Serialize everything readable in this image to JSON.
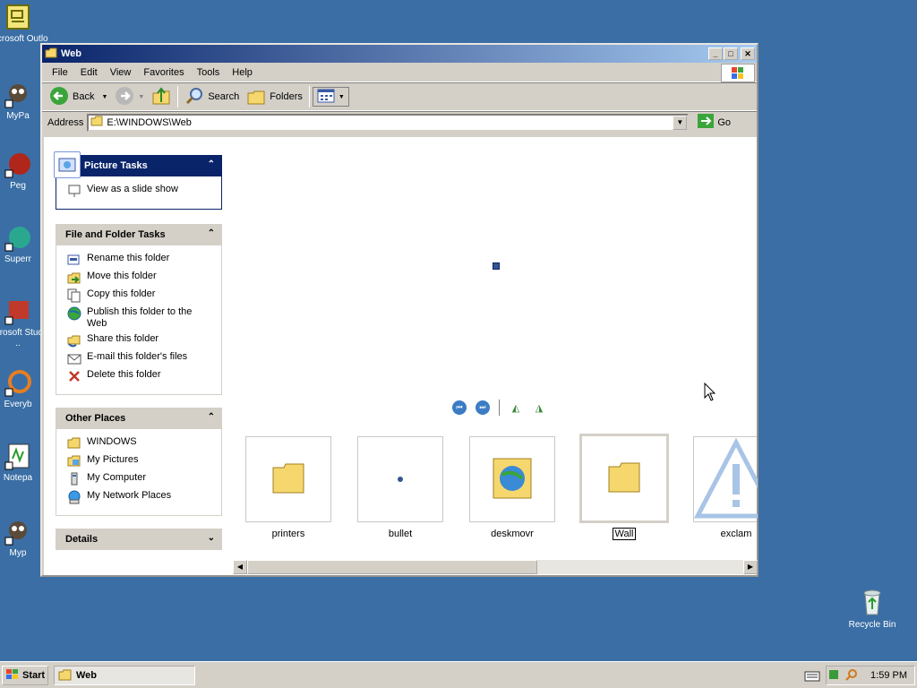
{
  "desktop": {
    "icons": [
      {
        "label": "Microsoft Outlo"
      },
      {
        "label": "MyPa"
      },
      {
        "label": "Peg"
      },
      {
        "label": "Superr"
      },
      {
        "label": "Microsoft Studio .."
      },
      {
        "label": "Everyb"
      },
      {
        "label": "Notepa"
      },
      {
        "label": "Myp"
      }
    ],
    "recycle_bin": "Recycle Bin"
  },
  "window": {
    "title": "Web",
    "menu": [
      "File",
      "Edit",
      "View",
      "Favorites",
      "Tools",
      "Help"
    ],
    "toolbar": {
      "back": "Back",
      "search": "Search",
      "folders": "Folders"
    },
    "address": {
      "label": "Address",
      "value": "E:\\WINDOWS\\Web",
      "go": "Go"
    }
  },
  "taskpane": {
    "picture_tasks": {
      "title": "Picture Tasks",
      "items": [
        "View as a slide show"
      ]
    },
    "file_folder_tasks": {
      "title": "File and Folder Tasks",
      "items": [
        "Rename this folder",
        "Move this folder",
        "Copy this folder",
        "Publish this folder to the Web",
        "Share this folder",
        "E-mail this folder's files",
        "Delete this folder"
      ]
    },
    "other_places": {
      "title": "Other Places",
      "items": [
        "WINDOWS",
        "My Pictures",
        "My Computer",
        "My Network Places"
      ]
    },
    "details": {
      "title": "Details"
    }
  },
  "filmstrip": {
    "items": [
      {
        "label": "printers"
      },
      {
        "label": "bullet"
      },
      {
        "label": "deskmovr"
      },
      {
        "label": "Wall"
      },
      {
        "label": "exclam"
      }
    ]
  },
  "taskbar": {
    "start": "Start",
    "task": "Web",
    "clock": "1:59 PM"
  }
}
